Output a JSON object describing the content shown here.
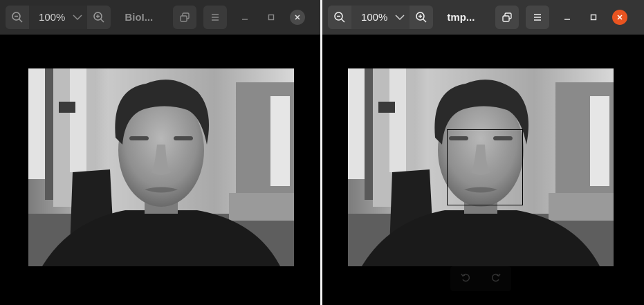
{
  "left_window": {
    "zoom_label": "100%",
    "title": "BioI...",
    "icons": [
      "zoom-out-icon",
      "chevron-down-icon",
      "zoom-in-icon",
      "copy-icon",
      "menu-icon",
      "minimize-icon",
      "maximize-icon",
      "close-icon"
    ]
  },
  "right_window": {
    "zoom_label": "100%",
    "title": "tmp...",
    "icons": [
      "zoom-out-icon",
      "chevron-down-icon",
      "zoom-in-icon",
      "copy-icon",
      "menu-icon",
      "minimize-icon",
      "maximize-icon",
      "close-icon",
      "rotate-left-icon",
      "rotate-right-icon"
    ],
    "face_detection_box": true
  },
  "colors": {
    "headerbar_inactive": "#2c2c2c",
    "headerbar_active": "#353535",
    "close_active": "#e95420",
    "close_inactive": "#4a4a4a",
    "canvas": "#000000"
  }
}
